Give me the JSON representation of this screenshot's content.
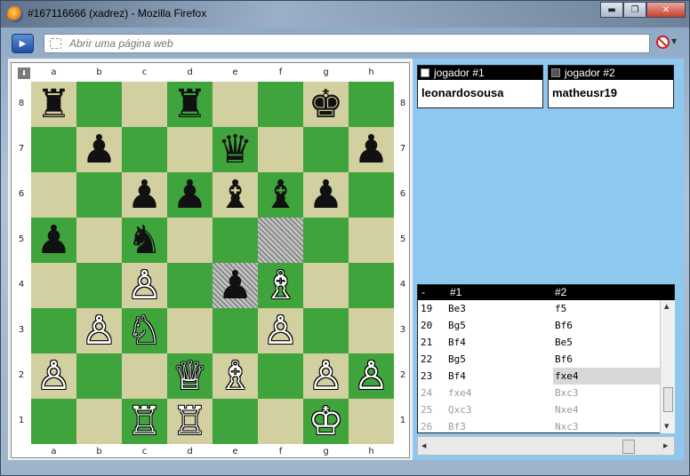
{
  "window": {
    "title": "#167116666 (xadrez) - Mozilla Firefox",
    "minimize": "▬",
    "maximize": "❐",
    "close": "✕"
  },
  "nav": {
    "back_glyph": "▶",
    "url_placeholder": "Abrir uma página web",
    "url_value": "",
    "block_arrow": "▼"
  },
  "board": {
    "flip_glyph": "⬇",
    "files": [
      "a",
      "b",
      "c",
      "d",
      "e",
      "f",
      "g",
      "h"
    ],
    "ranks": [
      "8",
      "7",
      "6",
      "5",
      "4",
      "3",
      "2",
      "1"
    ],
    "light_color": "#d2cfa1",
    "dark_color": "#3ea43b",
    "highlight": [
      "f5",
      "e4"
    ],
    "pieces": {
      "a8": "♜",
      "d8": "♜",
      "g8": "♚",
      "b7": "♟",
      "e7": "♛",
      "h7": "♟",
      "c6": "♟",
      "d6": "♟",
      "e6": "♝",
      "f6": "♝",
      "g6": "♟",
      "a5": "♟",
      "c5": "♞",
      "c4": "♙",
      "e4": "♟",
      "f4": "♗",
      "b3": "♙",
      "c3": "♘",
      "f3": "♙",
      "a2": "♙",
      "d2": "♕",
      "e2": "♗",
      "g2": "♙",
      "h2": "♙",
      "c1": "♖",
      "d1": "♖",
      "g1": "♔"
    },
    "white_pieces": [
      "c4",
      "f4",
      "b3",
      "c3",
      "f3",
      "a2",
      "d2",
      "e2",
      "g2",
      "h2",
      "c1",
      "d1",
      "g1"
    ]
  },
  "players": {
    "p1": {
      "label": "jogador #1",
      "name": "leonardosousa"
    },
    "p2": {
      "label": "jogador #2",
      "name": "matheusr19"
    }
  },
  "moves": {
    "headers": [
      "-",
      "#1",
      "#2"
    ],
    "rows": [
      {
        "n": "19",
        "w": "Be3",
        "b": "f5",
        "future": false
      },
      {
        "n": "20",
        "w": "Bg5",
        "b": "Bf6",
        "future": false
      },
      {
        "n": "21",
        "w": "Bf4",
        "b": "Be5",
        "future": false
      },
      {
        "n": "22",
        "w": "Bg5",
        "b": "Bf6",
        "future": false
      },
      {
        "n": "23",
        "w": "Bf4",
        "b": "fxe4",
        "future": false,
        "current": true
      },
      {
        "n": "24",
        "w": "fxe4",
        "b": "Bxc3",
        "future": true
      },
      {
        "n": "25",
        "w": "Qxc3",
        "b": "Nxe4",
        "future": true
      },
      {
        "n": "26",
        "w": "Bf3",
        "b": "Nxc3",
        "future": true
      }
    ],
    "scroll_up": "▲",
    "scroll_down": "▼",
    "scroll_left": "◀",
    "scroll_right": "▶"
  }
}
